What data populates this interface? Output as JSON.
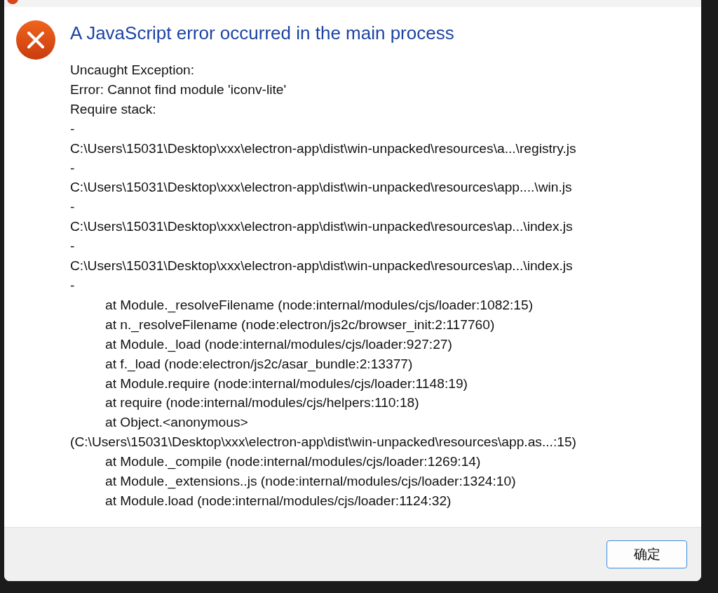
{
  "dialog": {
    "title": "A JavaScript error occurred in the main process",
    "lines": [
      {
        "kind": "plain",
        "text": "Uncaught Exception:"
      },
      {
        "kind": "plain",
        "text": "Error: Cannot find module 'iconv-lite'"
      },
      {
        "kind": "plain",
        "text": "Require stack:"
      },
      {
        "kind": "plain",
        "text": "-"
      },
      {
        "kind": "plain",
        "text": "C:\\Users\\15031\\Desktop\\xxx\\electron-app\\dist\\win-unpacked\\resources\\a...\\registry.js"
      },
      {
        "kind": "plain",
        "text": "-"
      },
      {
        "kind": "plain",
        "text": "C:\\Users\\15031\\Desktop\\xxx\\electron-app\\dist\\win-unpacked\\resources\\app....\\win.js"
      },
      {
        "kind": "plain",
        "text": "-"
      },
      {
        "kind": "plain",
        "text": "C:\\Users\\15031\\Desktop\\xxx\\electron-app\\dist\\win-unpacked\\resources\\ap...\\index.js"
      },
      {
        "kind": "plain",
        "text": "-"
      },
      {
        "kind": "plain",
        "text": "C:\\Users\\15031\\Desktop\\xxx\\electron-app\\dist\\win-unpacked\\resources\\ap...\\index.js"
      },
      {
        "kind": "plain",
        "text": "-"
      },
      {
        "kind": "frame",
        "text": "at Module._resolveFilename (node:internal/modules/cjs/loader:1082:15)"
      },
      {
        "kind": "frame",
        "text": "at n._resolveFilename (node:electron/js2c/browser_init:2:117760)"
      },
      {
        "kind": "frame",
        "text": "at Module._load (node:internal/modules/cjs/loader:927:27)"
      },
      {
        "kind": "frame",
        "text": "at f._load (node:electron/js2c/asar_bundle:2:13377)"
      },
      {
        "kind": "frame",
        "text": "at Module.require (node:internal/modules/cjs/loader:1148:19)"
      },
      {
        "kind": "frame",
        "text": "at require (node:internal/modules/cjs/helpers:110:18)"
      },
      {
        "kind": "frame",
        "text": "at Object.<anonymous>"
      },
      {
        "kind": "plain",
        "text": "(C:\\Users\\15031\\Desktop\\xxx\\electron-app\\dist\\win-unpacked\\resources\\app.as...:15)"
      },
      {
        "kind": "frame",
        "text": "at Module._compile (node:internal/modules/cjs/loader:1269:14)"
      },
      {
        "kind": "frame",
        "text": "at Module._extensions..js (node:internal/modules/cjs/loader:1324:10)"
      },
      {
        "kind": "frame",
        "text": "at Module.load (node:internal/modules/cjs/loader:1124:32)"
      }
    ],
    "buttons": [
      "确定"
    ]
  }
}
